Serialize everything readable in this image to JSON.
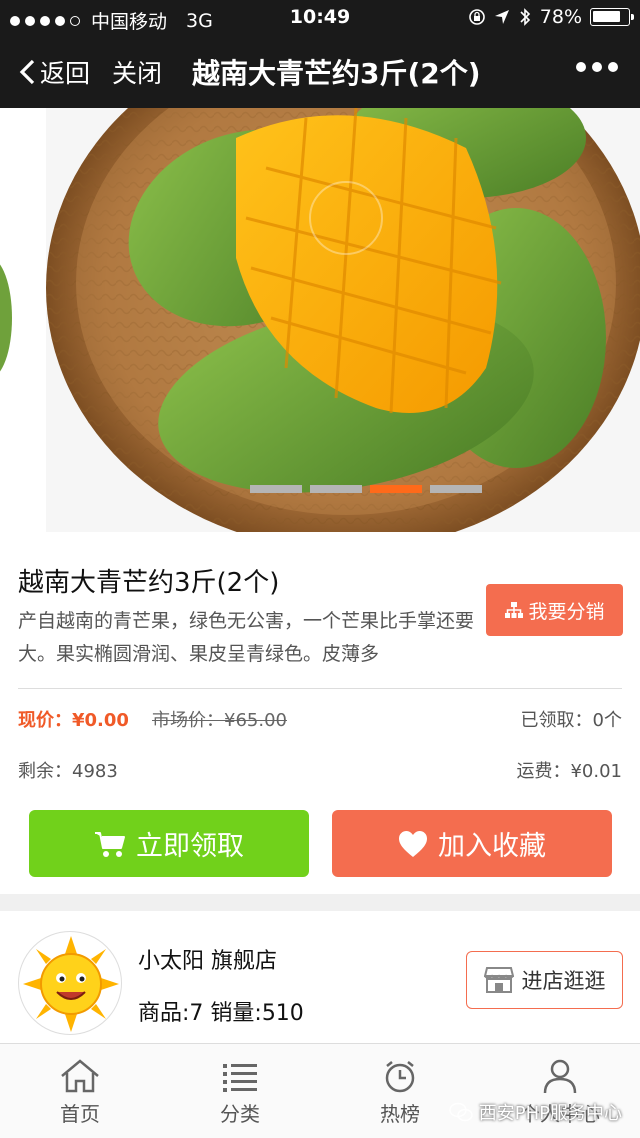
{
  "status_bar": {
    "carrier": "中国移动",
    "network": "3G",
    "time": "10:49",
    "battery": "78%",
    "battery_level": 0.78
  },
  "nav": {
    "back_label": "返回",
    "close_label": "关闭",
    "title": "越南大青芒约3斤(2个)"
  },
  "gallery": {
    "slides": 4,
    "active_index": 2,
    "accent": "#ff6a1a"
  },
  "product": {
    "title": "越南大青芒约3斤(2个)",
    "description": "产自越南的青芒果，绿色无公害，一个芒果比手掌还要大。果实椭圆滑润、果皮呈青绿色。皮薄多",
    "share_label": "我要分销",
    "price_label": "现价：¥0.00",
    "market_price": "市场价：¥65.00",
    "claimed": "已领取：0个",
    "remaining": "剩余：4983",
    "freight": "运费：¥0.01",
    "claim_button": "立即领取",
    "favorite_button": "加入收藏"
  },
  "shop": {
    "name": "小太阳 旗舰店",
    "stats": "商品:7 销量:510",
    "visit_button": "进店逛逛"
  },
  "tabbar": {
    "items": [
      {
        "label": "首页",
        "icon": "home-icon"
      },
      {
        "label": "分类",
        "icon": "list-icon"
      },
      {
        "label": "热榜",
        "icon": "clock-icon"
      },
      {
        "label": "个人中心",
        "icon": "user-icon"
      }
    ]
  },
  "watermark": {
    "text": "西安PHP服务中心"
  },
  "colors": {
    "accent_orange": "#f46d4f",
    "accent_green": "#71d11b",
    "price_red": "#f05a28"
  }
}
